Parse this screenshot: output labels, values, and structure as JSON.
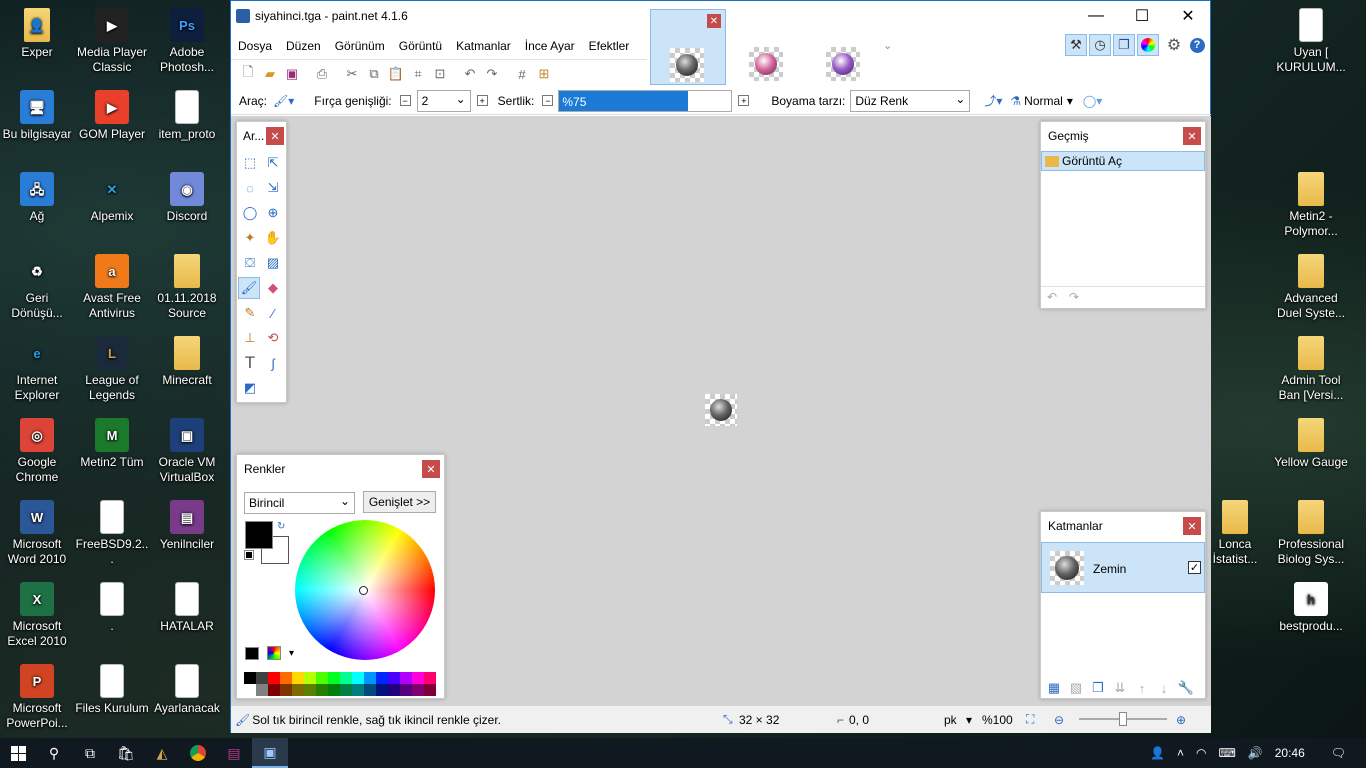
{
  "desktop_left": [
    {
      "label": "Exper",
      "icon": "user-folder-icon"
    },
    {
      "label": "Media Player Classic",
      "icon": "media-player-icon"
    },
    {
      "label": "Adobe Photosh...",
      "icon": "photoshop-icon"
    },
    {
      "label": "Bu bilgisayar",
      "icon": "computer-icon"
    },
    {
      "label": "GOM Player",
      "icon": "gom-player-icon"
    },
    {
      "label": "item_proto",
      "icon": "document-icon"
    },
    {
      "label": "Ağ",
      "icon": "network-icon"
    },
    {
      "label": "Alpemix",
      "icon": "alpemix-icon"
    },
    {
      "label": "Discord",
      "icon": "discord-icon"
    },
    {
      "label": "Geri Dönüşü...",
      "icon": "recycle-bin-icon"
    },
    {
      "label": "Avast Free Antivirus",
      "icon": "avast-icon"
    },
    {
      "label": "01.11.2018 Source",
      "icon": "folder-icon"
    },
    {
      "label": "Internet Explorer",
      "icon": "ie-icon"
    },
    {
      "label": "League of Legends",
      "icon": "lol-icon"
    },
    {
      "label": "Minecraft",
      "icon": "folder-icon"
    },
    {
      "label": "Google Chrome",
      "icon": "chrome-icon"
    },
    {
      "label": "Metin2 Tüm",
      "icon": "metin2-icon"
    },
    {
      "label": "Oracle VM VirtualBox",
      "icon": "virtualbox-icon"
    },
    {
      "label": "Microsoft Word 2010",
      "icon": "word-icon"
    },
    {
      "label": "FreeBSD9.2...",
      "icon": "document-icon"
    },
    {
      "label": "Yenilnciler",
      "icon": "winrar-icon"
    },
    {
      "label": "Microsoft Excel 2010",
      "icon": "excel-icon"
    },
    {
      "label": ".",
      "icon": "document-icon"
    },
    {
      "label": "HATALAR",
      "icon": "document-icon"
    },
    {
      "label": "Microsoft PowerPoi...",
      "icon": "powerpoint-icon"
    },
    {
      "label": "Files Kurulum",
      "icon": "document-icon"
    },
    {
      "label": "Ayarlanacak",
      "icon": "document-icon"
    }
  ],
  "desktop_right": [
    {
      "label": "Uyan [ KURULUM...",
      "icon": "document-icon"
    },
    {
      "label": "Metin2 - Polymor...",
      "icon": "folder-icon"
    },
    {
      "label": "Advanced Duel Syste...",
      "icon": "folder-icon"
    },
    {
      "label": "Admin Tool Ban [Versi...",
      "icon": "folder-icon"
    },
    {
      "label": "Yellow Gauge",
      "icon": "folder-icon"
    },
    {
      "label": "Lonca İstatist...",
      "icon": "folder-icon"
    },
    {
      "label": "Professional Biolog Sys...",
      "icon": "folder-icon"
    },
    {
      "label": "bestprodu...",
      "icon": "app-icon"
    }
  ],
  "window": {
    "title": "siyahinci.tga - paint.net 4.1.6"
  },
  "menu": [
    "Dosya",
    "Düzen",
    "Görünüm",
    "Görüntü",
    "Katmanlar",
    "İnce Ayar",
    "Efektler"
  ],
  "options": {
    "tool_label": "Araç:",
    "brush_width_label": "Fırça genişliği:",
    "brush_width_value": "2",
    "hardness_label": "Sertlik:",
    "hardness_value": "%75",
    "hardness_fraction": 0.75,
    "fill_label": "Boyama tarzı:",
    "fill_value": "Düz Renk",
    "blend_value": "Normal"
  },
  "tools_panel": {
    "title": "Ar..."
  },
  "colors_panel": {
    "title": "Renkler",
    "mode": "Birincil",
    "expand_button": "Genişlet >>",
    "primary_color": "#000000",
    "secondary_color": "#ffffff"
  },
  "history_panel": {
    "title": "Geçmiş",
    "items": [
      "Görüntü Aç"
    ]
  },
  "layers_panel": {
    "title": "Katmanlar",
    "layers": [
      {
        "name": "Zemin",
        "visible": true
      }
    ]
  },
  "status": {
    "hint": "Sol tık birincil renkle, sağ tık ikincil renkle çizer.",
    "size": "32 × 32",
    "position": "0, 0",
    "unit": "pk",
    "zoom": "%100"
  },
  "taskbar": {
    "time": "20:46"
  }
}
